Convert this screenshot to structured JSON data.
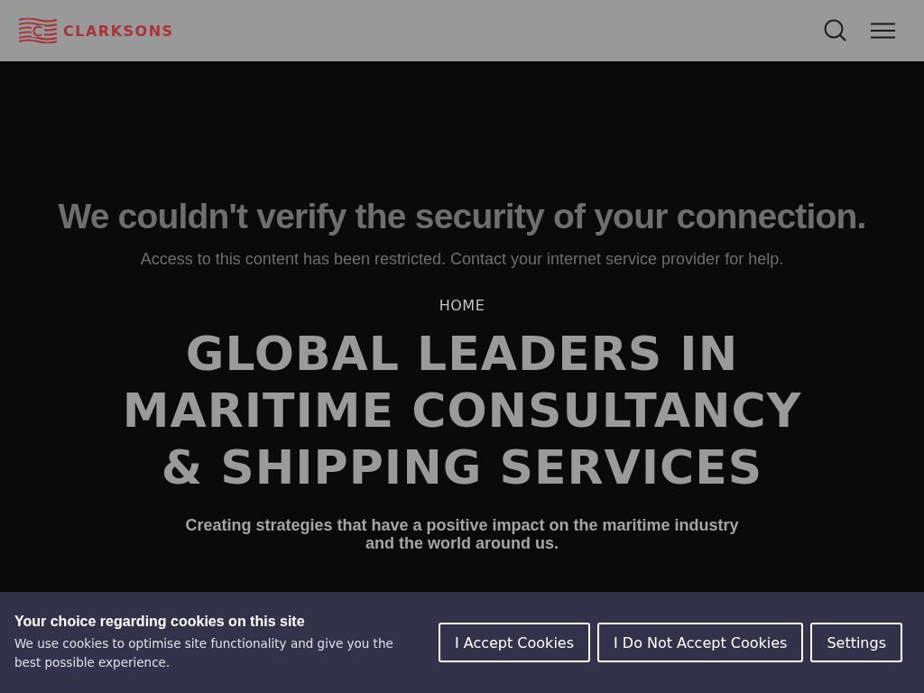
{
  "header": {
    "logo_text": "CLARKSONS"
  },
  "error": {
    "title": "We couldn't verify the security of your connection.",
    "message": "Access to this content has been restricted. Contact your internet service provider for help."
  },
  "hero": {
    "breadcrumb": "HOME",
    "title_lines": [
      "GLOBAL LEADERS IN",
      "MARITIME CONSULTANCY",
      "& SHIPPING SERVICES"
    ],
    "subtitle": "Creating strategies that have a positive impact on the maritime industry and the world around us."
  },
  "cookie_banner": {
    "title": "Your choice regarding cookies on this site",
    "text": "We use cookies to optimise site functionality and give you the best possible experience.",
    "buttons": [
      "I Accept Cookies",
      "I Do Not Accept Cookies",
      "Settings"
    ]
  }
}
